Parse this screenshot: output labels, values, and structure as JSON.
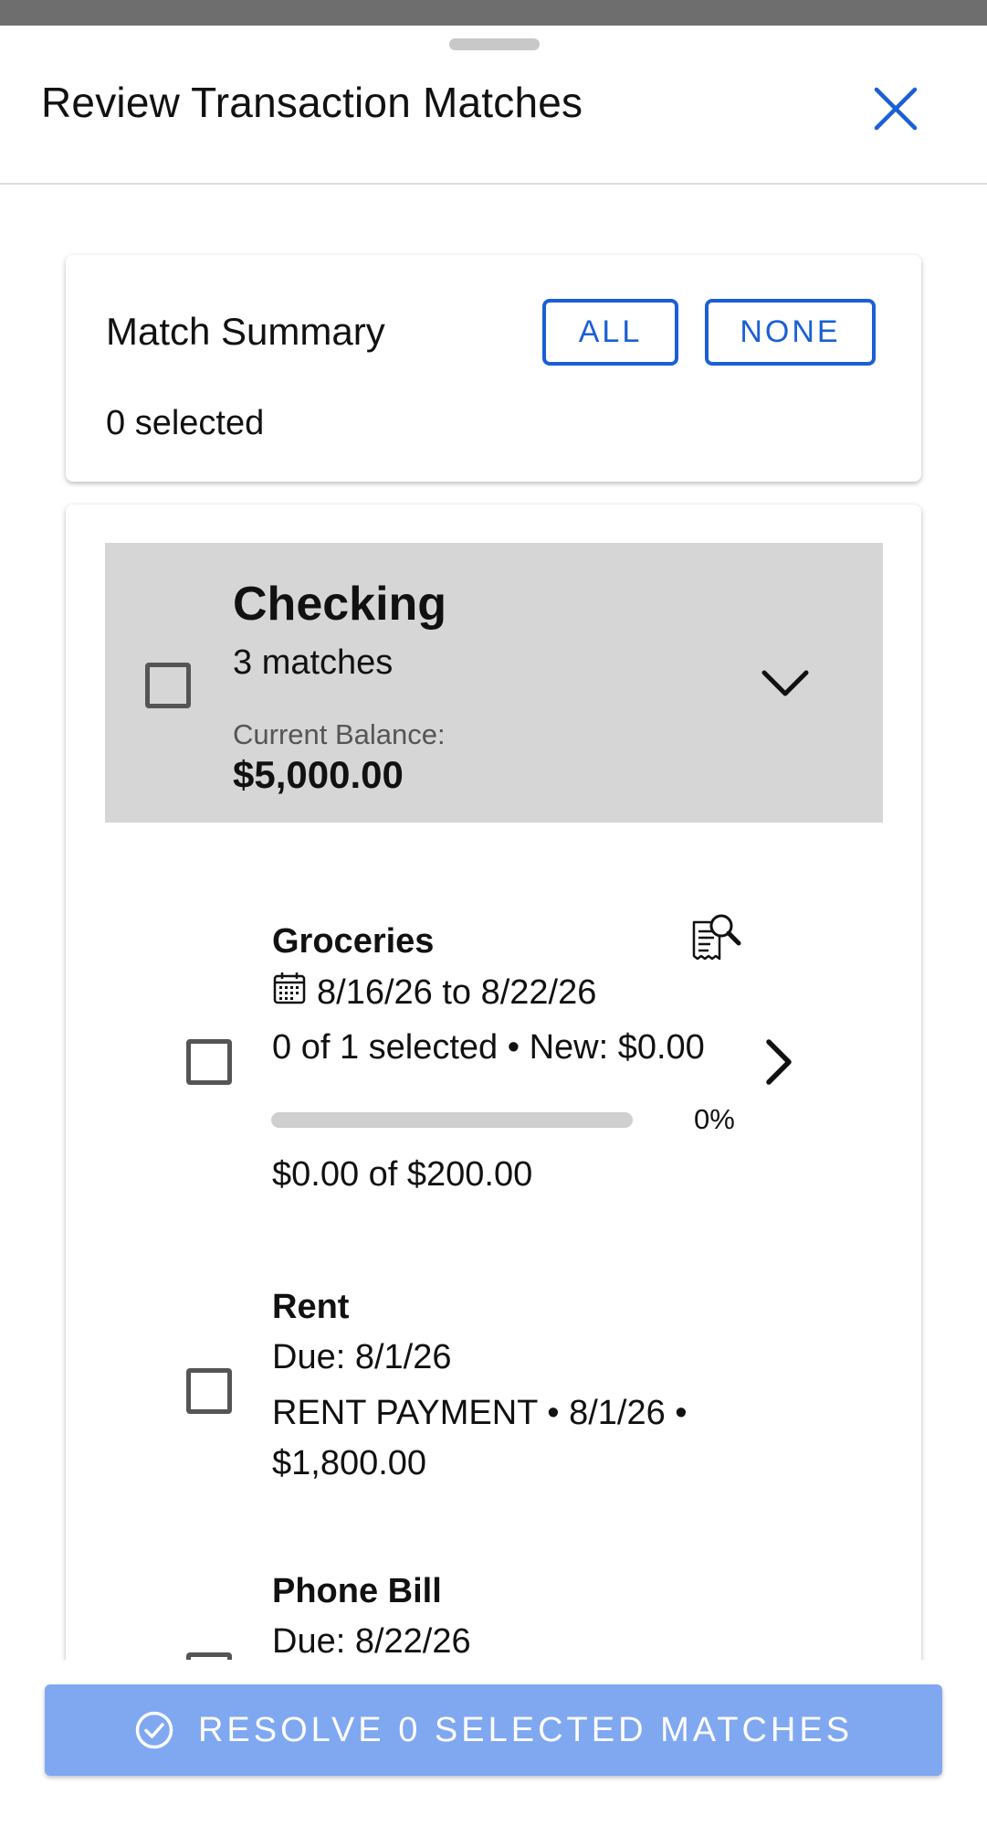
{
  "header": {
    "title": "Review Transaction Matches",
    "close_icon": "close-icon"
  },
  "summary": {
    "title": "Match Summary",
    "all_label": "ALL",
    "none_label": "NONE",
    "selected_text": "0 selected"
  },
  "account": {
    "name": "Checking",
    "matches": "3 matches",
    "balance_label": "Current Balance:",
    "balance": "$5,000.00",
    "expand_icon": "chevron-down-icon"
  },
  "items": [
    {
      "title": "Groceries",
      "date_range": "8/16/26 to 8/22/26",
      "selection": "0 of 1 selected • New: $0.00",
      "progress": 0,
      "progress_label": "0%",
      "amount": "$0.00 of $200.00",
      "icons": [
        "calendar-icon",
        "receipt-search-icon",
        "chevron-right-icon"
      ]
    },
    {
      "title": "Rent",
      "due": "Due: 8/1/26",
      "detail_line1": "RENT PAYMENT • 8/1/26 •",
      "detail_line2": "$1,800.00"
    },
    {
      "title": "Phone Bill",
      "due": "Due: 8/22/26"
    }
  ],
  "footer": {
    "resolve_label": "RESOLVE 0 SELECTED MATCHES",
    "resolve_icon": "check-circle-icon"
  },
  "colors": {
    "accent": "#1a5fd6",
    "resolve_button": "#80a8f0",
    "account_header_bg": "#d6d6d6"
  }
}
